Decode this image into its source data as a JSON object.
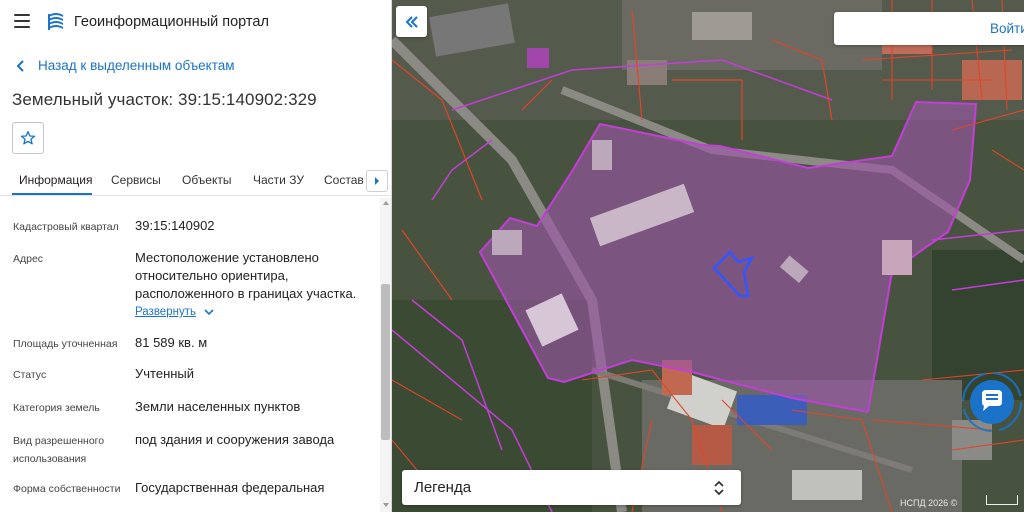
{
  "header": {
    "app_title": "Геоинформационный портал",
    "menu_icon": "menu-icon",
    "logo_icon": "portal-logo-icon"
  },
  "back_link": {
    "label": "Назад к выделенным объектам",
    "icon": "chevron-left-icon"
  },
  "parcel_title": "Земельный участок: 39:15:140902:329",
  "favorite_icon": "star-icon",
  "tabs": [
    {
      "label": "Информация",
      "active": true
    },
    {
      "label": "Сервисы",
      "active": false
    },
    {
      "label": "Объекты",
      "active": false
    },
    {
      "label": "Части ЗУ",
      "active": false
    },
    {
      "label": "Состав",
      "active": false
    }
  ],
  "info": {
    "cadastral_quarter": {
      "label": "Кадастровый квартал",
      "value": "39:15:140902"
    },
    "address": {
      "label": "Адрес",
      "lines": [
        "Местоположение установлено",
        "относительно ориентира,",
        "расположенного в границах участка."
      ],
      "expand_label": "Развернуть"
    },
    "area": {
      "label": "Площадь уточненная",
      "value": "81 589 кв. м"
    },
    "status": {
      "label": "Статус",
      "value": "Учтенный"
    },
    "land_category": {
      "label": "Категория земель",
      "value": "Земли населенных пунктов"
    },
    "permitted_use": {
      "label_line1": "Вид разрешенного",
      "label_line2": "использования",
      "value": "под здания и сооружения завода"
    },
    "ownership": {
      "label": "Форма собственности",
      "value": "Государственная федеральная"
    }
  },
  "map": {
    "login_label": "Войти",
    "legend_label": "Легенда",
    "credit": "НСПД 2026 ©",
    "colors": {
      "parcel_fill": "#9b57a8",
      "parcel_border": "#c23fd6",
      "boundary_red": "#e0452a",
      "selected_outline": "#3355ff",
      "accent": "#1a73c8"
    }
  }
}
